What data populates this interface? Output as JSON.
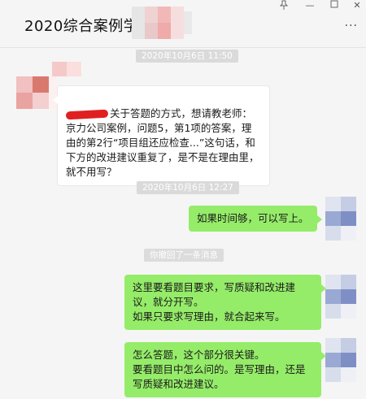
{
  "window": {
    "title": "2020综合案例学习",
    "pin_icon": "pin-icon",
    "more_label": "···"
  },
  "messages": {
    "ts1": "2020年10月6日 11:50",
    "incoming_text": "关于答题的方式，想请教老师：京力公司案例，问题5，第1项的答案，理由的第2行“项目组还应检查...”这句话，和下方的改进建议重复了，是不是在理由里，就不用写？",
    "ts2": "2020年10月6日 12:27",
    "out1": "如果时间够，可以写上。",
    "recall_notice": "你撤回了一条消息",
    "out2": "这里要看题目要求，写质疑和改进建议，就分开写。\n如果只要求写理由，就合起来写。",
    "out3": "怎么答题，这个部分很关键。\n要看题目中怎么问的。是写理由，还是写质疑和改进建议。"
  },
  "colors": {
    "background": "#f5f5f5",
    "outgoing_bubble": "#95ec69",
    "incoming_bubble": "#ffffff",
    "timestamp_bg": "#dadada"
  }
}
